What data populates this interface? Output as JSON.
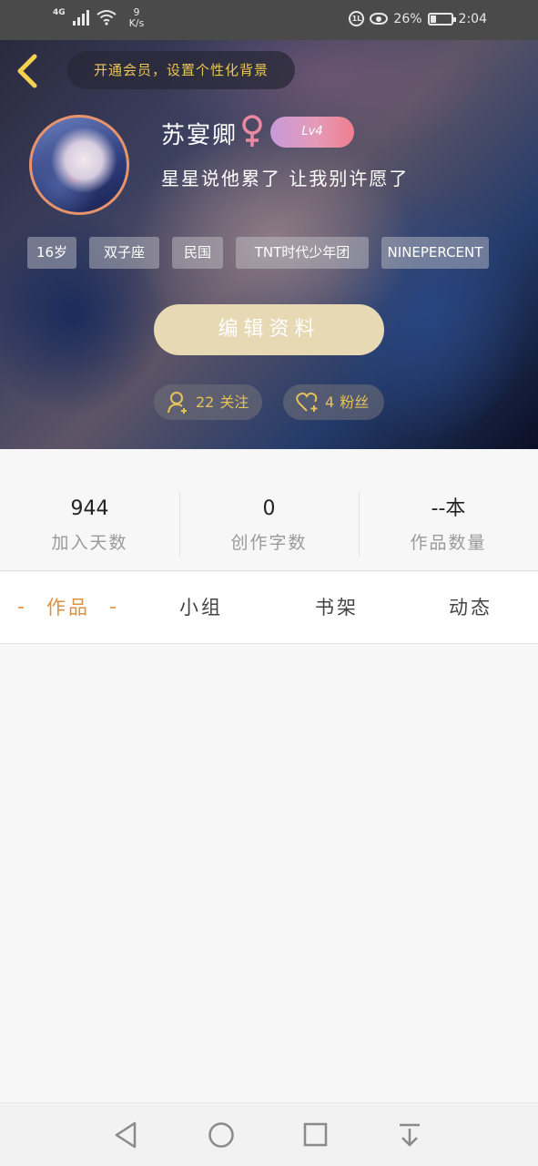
{
  "status_bar": {
    "network": "4G",
    "speed_value": "9",
    "speed_unit": "K/s",
    "battery_percent": "26%",
    "time": "2:04"
  },
  "header": {
    "vip_banner": "开通会员，设置个性化背景",
    "username": "苏宴卿",
    "gender": "female-icon",
    "level": "Lv4",
    "bio": "星星说他累了 让我别许愿了",
    "tags": [
      "16岁",
      "双子座",
      "民国",
      "TNT时代少年团",
      "NINEPERCENT"
    ],
    "edit_button": "编辑资料",
    "following_count": "22",
    "following_label": "关注",
    "fans_count": "4",
    "fans_label": "粉丝"
  },
  "stats": [
    {
      "value": "944",
      "label": "加入天数"
    },
    {
      "value": "0",
      "label": "创作字数"
    },
    {
      "value": "--本",
      "label": "作品数量"
    }
  ],
  "tabs": [
    {
      "label": "作品",
      "active": true
    },
    {
      "label": "小组",
      "active": false
    },
    {
      "label": "书架",
      "active": false
    },
    {
      "label": "动态",
      "active": false
    }
  ],
  "nav": [
    "back-icon",
    "home-icon",
    "recents-icon",
    "notification-drawer-icon"
  ],
  "colors": {
    "accent_gold": "#e9c55a",
    "active_tab": "#d9923f",
    "edit_button_bg": "#e6d9b3",
    "gender_pink": "#e98aa2"
  }
}
